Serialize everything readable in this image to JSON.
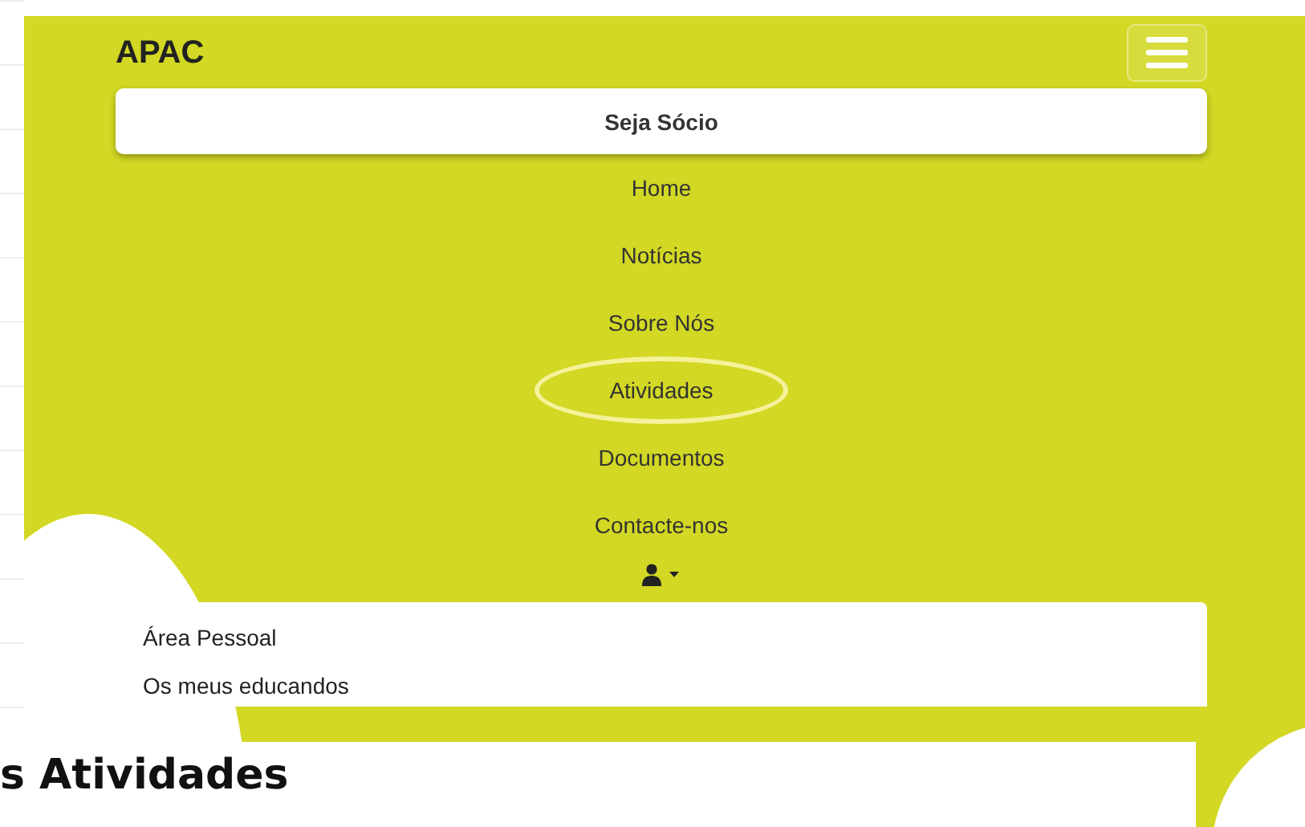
{
  "navbar": {
    "brand": "APAC",
    "menu_expanded": true
  },
  "cta_button": {
    "label": "Seja Sócio"
  },
  "nav_items": [
    {
      "label": "Home",
      "highlighted": false
    },
    {
      "label": "Notícias",
      "highlighted": false
    },
    {
      "label": "Sobre Nós",
      "highlighted": false
    },
    {
      "label": "Atividades",
      "highlighted": true
    },
    {
      "label": "Documentos",
      "highlighted": false
    },
    {
      "label": "Contacte-nos",
      "highlighted": false
    }
  ],
  "user_menu": {
    "expanded": true,
    "items": [
      {
        "label": "Área Pessoal"
      },
      {
        "label": "Os meus educandos"
      }
    ]
  },
  "page_heading": "s Atividades"
}
